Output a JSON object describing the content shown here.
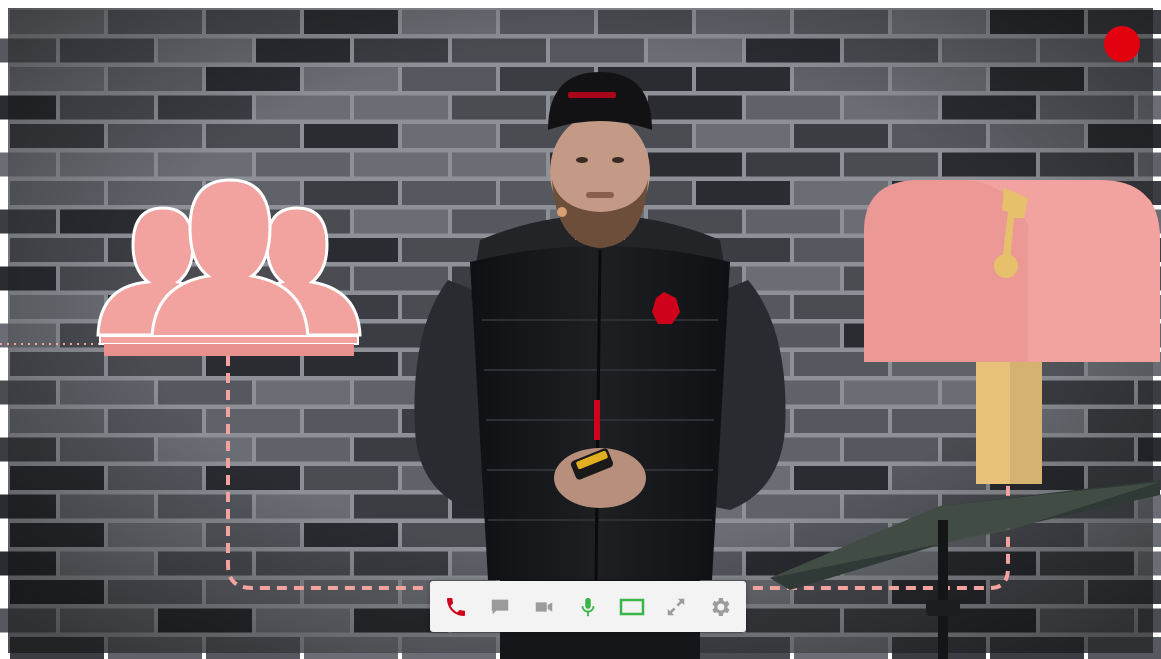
{
  "colors": {
    "wall_base": "#4a4c52",
    "brick_dark": "#2a2c31",
    "brick_light": "#6a6d73",
    "mortar": "#8d9096",
    "illustration_pink": "#f2a3a0",
    "illustration_pink_dark": "#e8908d",
    "mailbox_flag": "#e6c06a",
    "post_yellow": "#e8c27a",
    "connector_dash": "#f2a3a0",
    "recording_dot": "#e3000f",
    "toolbar_bg": "#f3f3f3",
    "hangup_red": "#d0021b",
    "mic_green": "#39b54a",
    "screen_green": "#39b54a",
    "icon_grey": "#9b9b9b"
  },
  "recording_indicator": {
    "icon": "record-dot",
    "active": true
  },
  "illustrations": {
    "left": {
      "icon": "user-group-icon"
    },
    "right": {
      "icon": "mailbox-icon"
    }
  },
  "presenter": {
    "description_icon": "presenter-figure"
  },
  "toolbar": {
    "buttons": [
      {
        "name": "hangup-button",
        "icon": "phone-hangup-icon",
        "active": true
      },
      {
        "name": "chat-button",
        "icon": "chat-bubble-icon",
        "active": false
      },
      {
        "name": "camera-button",
        "icon": "video-camera-icon",
        "active": false
      },
      {
        "name": "microphone-button",
        "icon": "microphone-icon",
        "active": true
      },
      {
        "name": "screen-share-button",
        "icon": "screen-share-icon",
        "active": true
      },
      {
        "name": "fullscreen-button",
        "icon": "expand-arrows-icon",
        "active": false
      },
      {
        "name": "settings-button",
        "icon": "gear-icon",
        "active": false
      }
    ]
  }
}
